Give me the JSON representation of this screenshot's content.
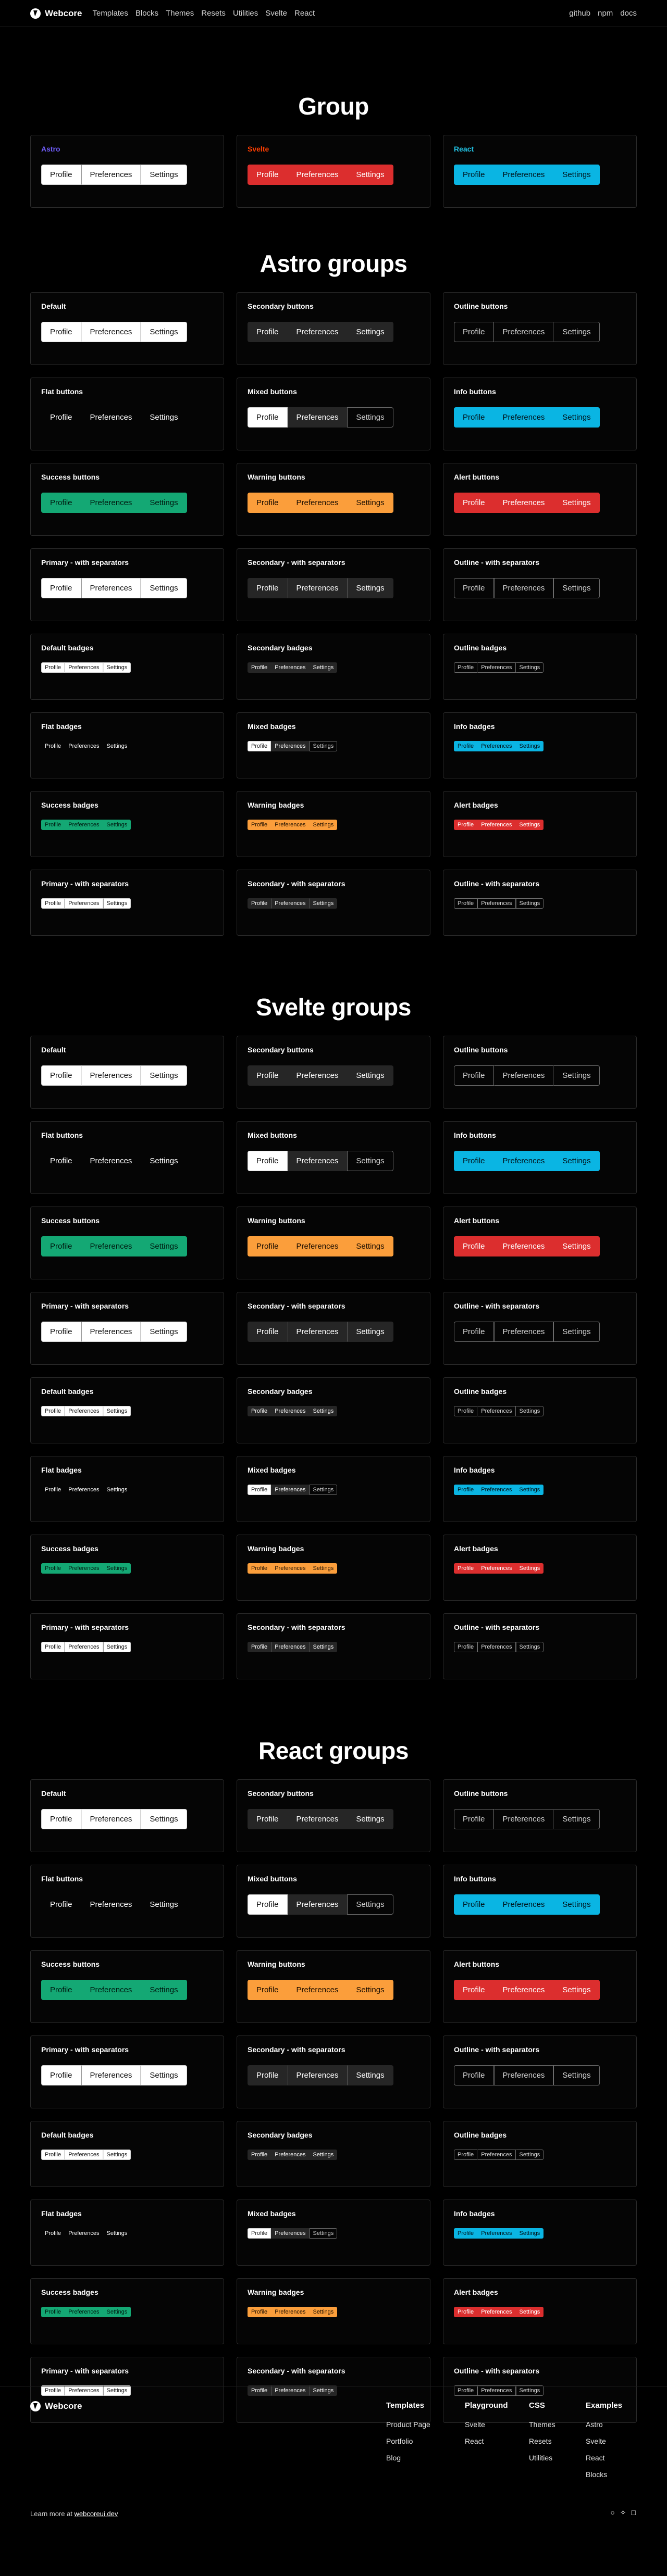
{
  "nav": {
    "brand": "Webcore",
    "links": [
      "Templates",
      "Blocks",
      "Themes",
      "Resets",
      "Utilities",
      "Svelte",
      "React"
    ],
    "right_links": [
      "github",
      "npm",
      "docs"
    ]
  },
  "labels": [
    "Profile",
    "Preferences",
    "Settings"
  ],
  "group_section": {
    "title": "Group",
    "cards": [
      {
        "title": "Astro",
        "title_color": "#6d5bf5",
        "variant": "default"
      },
      {
        "title": "Svelte",
        "title_color": "#ff3e00",
        "variant": "alert"
      },
      {
        "title": "React",
        "title_color": "#22c6e8",
        "variant": "info"
      }
    ]
  },
  "sections": [
    {
      "title": "Astro groups"
    },
    {
      "title": "Svelte groups"
    },
    {
      "title": "React groups"
    }
  ],
  "cards": [
    {
      "title": "Default",
      "variant": "default",
      "kind": "btn",
      "sep": false
    },
    {
      "title": "Secondary buttons",
      "variant": "secondary",
      "kind": "btn",
      "sep": false
    },
    {
      "title": "Outline buttons",
      "variant": "outline",
      "kind": "btn",
      "sep": false
    },
    {
      "title": "Flat buttons",
      "variant": "flat",
      "kind": "btn",
      "sep": false
    },
    {
      "title": "Mixed buttons",
      "variant": "mixed",
      "kind": "btn",
      "sep": false
    },
    {
      "title": "Info buttons",
      "variant": "info",
      "kind": "btn",
      "sep": false
    },
    {
      "title": "Success buttons",
      "variant": "success",
      "kind": "btn",
      "sep": false
    },
    {
      "title": "Warning buttons",
      "variant": "warning",
      "kind": "btn",
      "sep": false
    },
    {
      "title": "Alert buttons",
      "variant": "alert",
      "kind": "btn",
      "sep": false
    },
    {
      "title": "Primary - with separators",
      "variant": "default",
      "kind": "btn",
      "sep": true
    },
    {
      "title": "Secondary - with separators",
      "variant": "secondary",
      "kind": "btn",
      "sep": true
    },
    {
      "title": "Outline - with separators",
      "variant": "outline",
      "kind": "btn",
      "sep": true
    },
    {
      "title": "Default badges",
      "variant": "default",
      "kind": "badge",
      "sep": false
    },
    {
      "title": "Secondary badges",
      "variant": "secondary",
      "kind": "badge",
      "sep": false
    },
    {
      "title": "Outline badges",
      "variant": "outline",
      "kind": "badge",
      "sep": false
    },
    {
      "title": "Flat badges",
      "variant": "flat",
      "kind": "badge",
      "sep": false
    },
    {
      "title": "Mixed badges",
      "variant": "mixed",
      "kind": "badge",
      "sep": false
    },
    {
      "title": "Info badges",
      "variant": "info",
      "kind": "badge",
      "sep": false
    },
    {
      "title": "Success badges",
      "variant": "success",
      "kind": "badge",
      "sep": false
    },
    {
      "title": "Warning badges",
      "variant": "warning",
      "kind": "badge",
      "sep": false
    },
    {
      "title": "Alert badges",
      "variant": "alert",
      "kind": "badge",
      "sep": false
    },
    {
      "title": "Primary - with separators",
      "variant": "default",
      "kind": "badge",
      "sep": true
    },
    {
      "title": "Secondary - with separators",
      "variant": "secondary",
      "kind": "badge",
      "sep": true
    },
    {
      "title": "Outline - with separators",
      "variant": "outline",
      "kind": "badge",
      "sep": true
    }
  ],
  "footer": {
    "brand": "Webcore",
    "columns": [
      {
        "title": "Templates",
        "links": [
          "Product Page",
          "Portfolio",
          "Blog"
        ]
      },
      {
        "title": "Playground",
        "links": [
          "Svelte",
          "React"
        ]
      },
      {
        "title": "CSS",
        "links": [
          "Themes",
          "Resets",
          "Utilities"
        ]
      },
      {
        "title": "Examples",
        "links": [
          "Astro",
          "Svelte",
          "React",
          "Blocks"
        ]
      }
    ],
    "learn_prefix": "Learn more at ",
    "learn_link": "webcoreui.dev",
    "icons": [
      "github-icon",
      "webcore-icon",
      "docs-icon"
    ]
  }
}
